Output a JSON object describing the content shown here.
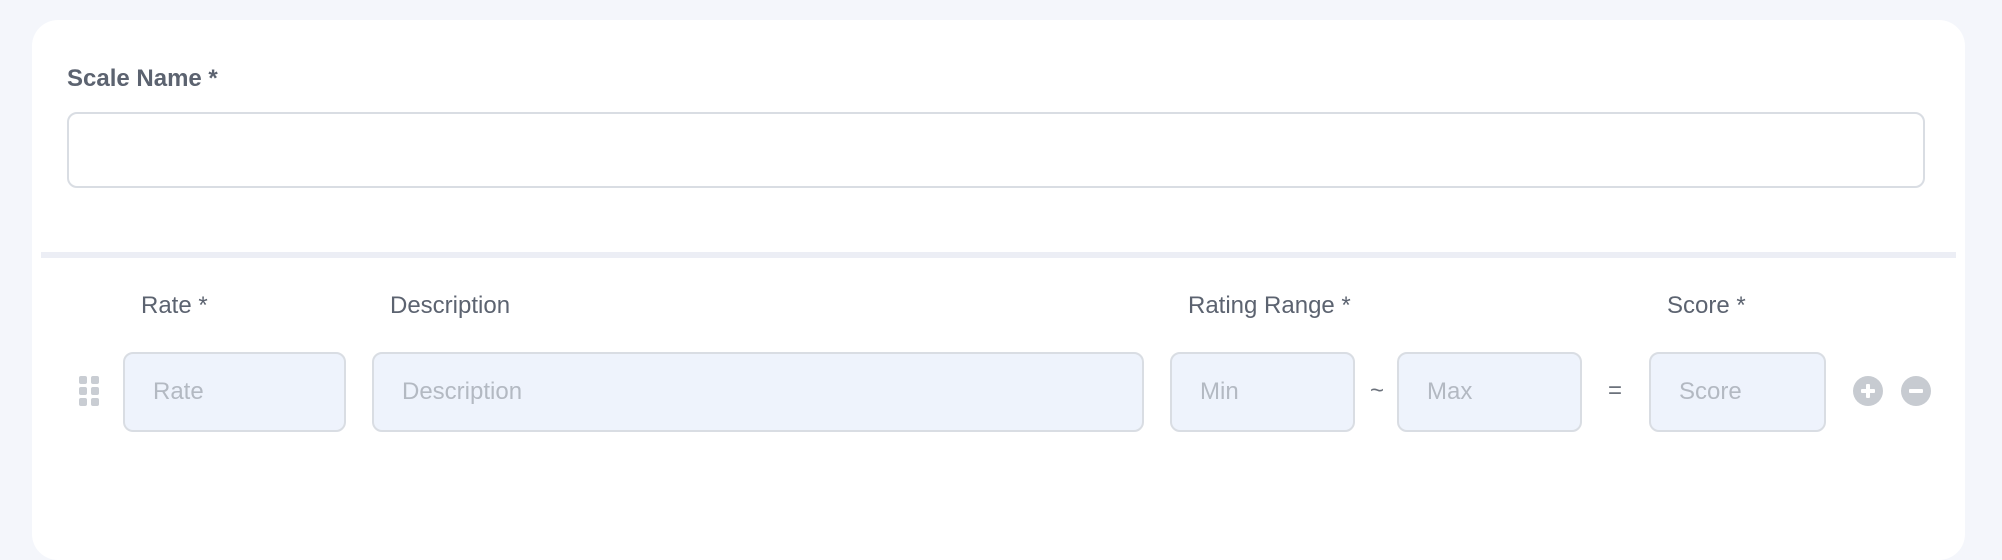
{
  "scale": {
    "label": "Scale Name *",
    "value": "",
    "placeholder": ""
  },
  "columns": {
    "rate": "Rate *",
    "description": "Description",
    "rating_range": "Rating Range *",
    "score": "Score *"
  },
  "row": {
    "rate_placeholder": "Rate",
    "description_placeholder": "Description",
    "min_placeholder": "Min",
    "max_placeholder": "Max",
    "score_placeholder": "Score",
    "range_separator": "~",
    "equals_sign": "="
  },
  "icons": {
    "drag": "drag-handle-icon",
    "add": "plus-circle-icon",
    "remove": "minus-circle-icon"
  },
  "colors": {
    "page_background": "#f4f6fb",
    "card_background": "#ffffff",
    "input_fill": "#eef3fc",
    "input_border": "#d9dde3",
    "label_text": "#5c6370",
    "placeholder_text": "#b3b9c2",
    "icon_gray": "#c7cbd1"
  }
}
